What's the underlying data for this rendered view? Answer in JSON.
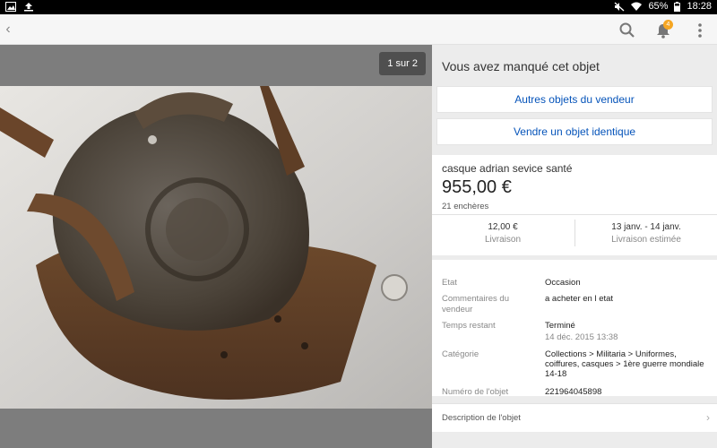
{
  "status_bar": {
    "battery": "65%",
    "time": "18:28",
    "icons_left": [
      "image-icon",
      "upload-icon"
    ],
    "icons_right": [
      "mute-icon",
      "wifi-icon",
      "battery-icon"
    ]
  },
  "toolbar": {
    "back_icon": "chevron-left-icon",
    "search_icon": "search-icon",
    "notification_icon": "bell-icon",
    "notification_count": "4",
    "menu_icon": "more-vert-icon"
  },
  "gallery": {
    "counter": "1 sur 2"
  },
  "panel": {
    "missed_heading": "Vous avez manqué cet objet",
    "seller_items_button": "Autres objets du vendeur",
    "sell_similar_button": "Vendre un objet identique"
  },
  "listing": {
    "title": "casque adrian sevice santé",
    "price": "955,00 €",
    "bids": "21 enchères",
    "shipping_cost": "12,00 €",
    "shipping_label": "Livraison",
    "delivery_dates": "13 janv. - 14 janv.",
    "delivery_label": "Livraison estimée"
  },
  "specs": {
    "condition_label": "Etat",
    "condition_value": "Occasion",
    "comments_label": "Commentaires du vendeur",
    "comments_value": "a acheter en l etat",
    "time_left_label": "Temps restant",
    "time_left_value": "Terminé",
    "time_left_date": "14 déc. 2015 13:38",
    "category_label": "Catégorie",
    "category_value": "Collections > Militaria > Uniformes, coiffures, casques > 1ère guerre mondiale 14-18",
    "item_number_label": "Numéro de l'objet",
    "item_number_value": "221964045898"
  },
  "description": {
    "label": "Description de l'objet"
  },
  "colors": {
    "link": "#0654ba",
    "badge": "#f5a623",
    "panel_bg": "#ececec"
  }
}
